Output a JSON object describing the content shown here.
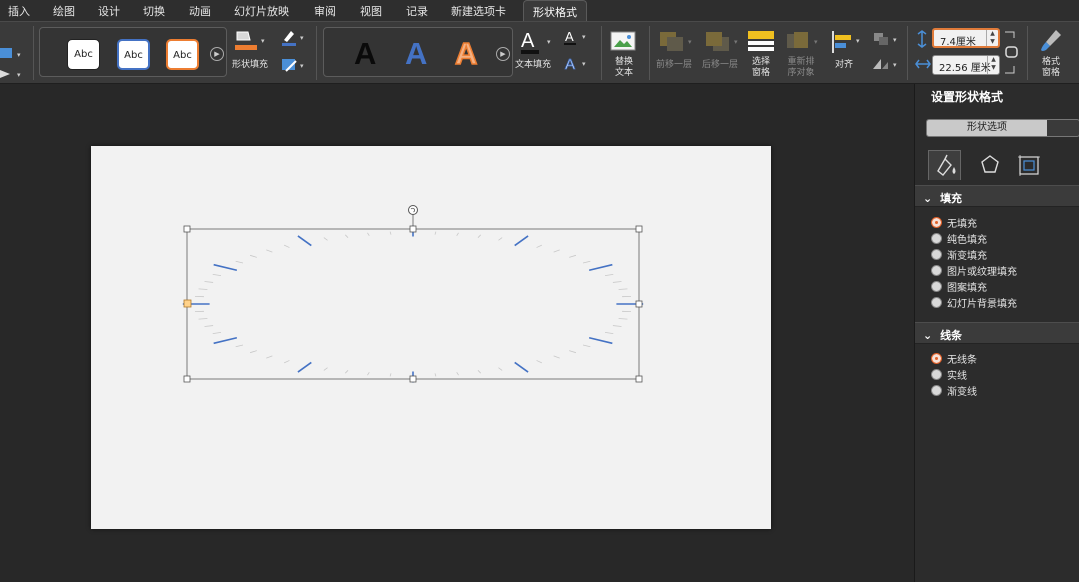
{
  "tabs": [
    "插入",
    "绘图",
    "设计",
    "切换",
    "动画",
    "幻灯片放映",
    "审阅",
    "视图",
    "记录",
    "新建选项卡",
    "形状格式"
  ],
  "active_tab": "形状格式",
  "ribbon": {
    "style_label": "Abc",
    "shape_fill": "形状填充",
    "wordart_letter": "A",
    "text_fill": "文本填充",
    "alt_text": "替换\n文本",
    "bring_forward": "前移一层",
    "send_backward": "后移一层",
    "selection_pane": "选择\n窗格",
    "reorder_objects": "重新排\n序对象",
    "align": "对齐",
    "height_value": "7.4厘米",
    "width_value": "22.56 厘米",
    "format_pane": "格式\n窗格"
  },
  "colors": {
    "accent_orange": "#e2622a",
    "tick_blue": "#4472c4",
    "fill_orange": "#ed7d31",
    "selection_handle": "#ffffff"
  },
  "panel": {
    "title": "设置形状格式",
    "segment_label": "形状选项",
    "icons": [
      "fill-line-icon",
      "effects-pentagon-icon",
      "size-properties-icon"
    ],
    "fill_section": "填充",
    "fill_options": [
      "无填充",
      "纯色填充",
      "渐变填充",
      "图片或纹理填充",
      "图案填充",
      "幻灯片背景填充"
    ],
    "fill_selected": 0,
    "line_section": "线条",
    "line_options": [
      "无线条",
      "实线",
      "渐变线"
    ],
    "line_selected": 0
  }
}
